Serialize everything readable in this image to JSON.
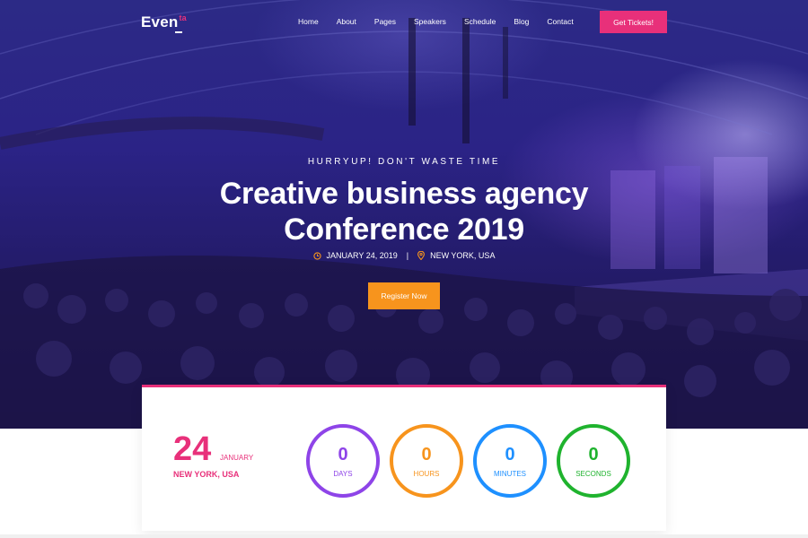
{
  "brand": {
    "logo_main": "Even",
    "logo_sup": "ta"
  },
  "nav": {
    "links": [
      "Home",
      "About",
      "Pages",
      "Speakers",
      "Schedule",
      "Blog",
      "Contact"
    ],
    "cta_label": "Get Tickets!"
  },
  "hero": {
    "tagline": "HURRYUP! DON'T WASTE TIME",
    "title_line1": "Creative business agency",
    "title_line2": "Conference 2019",
    "date": "JANUARY 24, 2019",
    "separator": "|",
    "location": "NEW YORK, USA",
    "register_label": "Register Now"
  },
  "countdown": {
    "day": "24",
    "month": "JANUARY",
    "location": "NEW YORK, USA",
    "units": [
      {
        "value": "0",
        "label": "DAYS",
        "color": "#8e44e8"
      },
      {
        "value": "0",
        "label": "HOURS",
        "color": "#f7941d"
      },
      {
        "value": "0",
        "label": "MINUTES",
        "color": "#1e90ff"
      },
      {
        "value": "0",
        "label": "SECONDS",
        "color": "#1fb32e"
      }
    ]
  },
  "colors": {
    "accent_pink": "#e8307a",
    "accent_orange": "#f7941d",
    "hero_overlay": "#2b2386"
  },
  "icons": {
    "date_icon": "clock-icon",
    "location_icon": "map-pin-icon"
  }
}
